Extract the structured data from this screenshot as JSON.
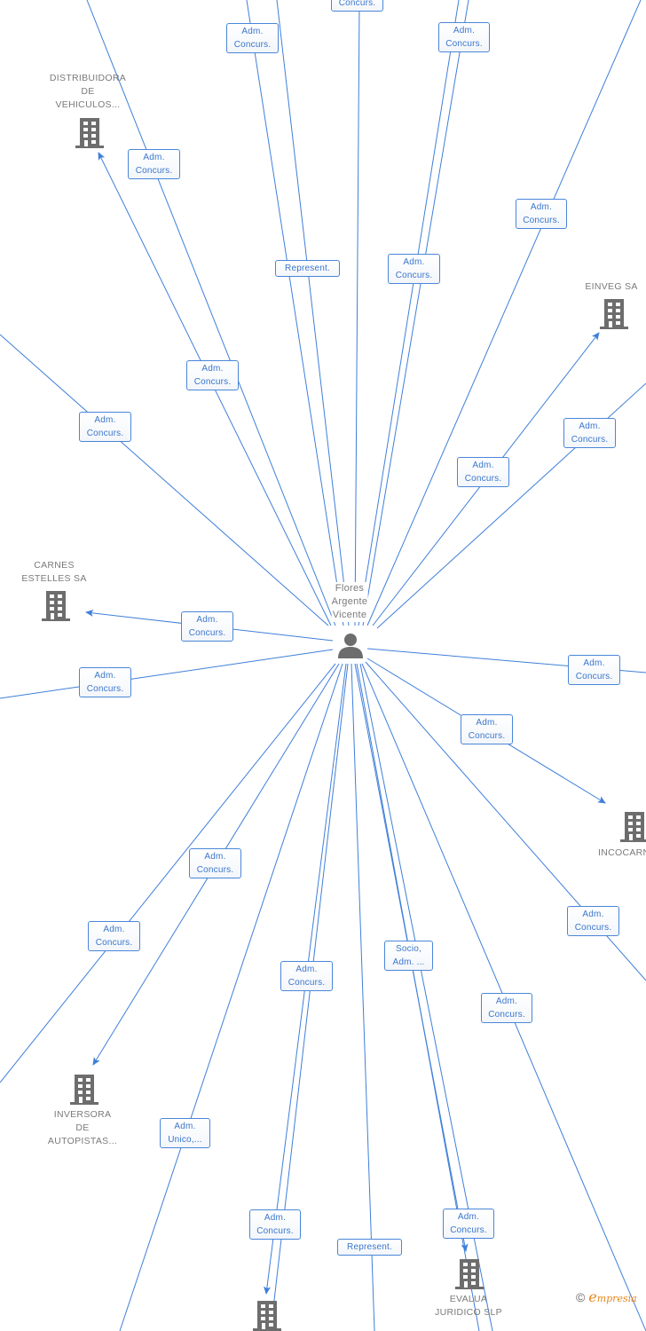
{
  "center": {
    "name_lines": [
      "Flores",
      "Argente",
      "Vicente"
    ],
    "icon": "person-icon"
  },
  "companies": [
    {
      "id": "distribuidora",
      "lines": [
        "DISTRIBUIDORA",
        "DE",
        "VEHICULOS..."
      ],
      "icon": "building-icon"
    },
    {
      "id": "einveg",
      "lines": [
        "EINVEG SA"
      ],
      "icon": "building-icon"
    },
    {
      "id": "carnes",
      "lines": [
        "CARNES",
        "ESTELLES SA"
      ],
      "icon": "building-icon"
    },
    {
      "id": "incocarn",
      "lines": [
        "INCOCARN"
      ],
      "icon": "building-icon"
    },
    {
      "id": "inversora",
      "lines": [
        "INVERSORA",
        "DE",
        "AUTOPISTAS..."
      ],
      "icon": "building-icon"
    },
    {
      "id": "evalua",
      "lines": [
        "EVALUA",
        "JURIDICO SLP"
      ],
      "icon": "building-icon"
    },
    {
      "id": "bottom-company",
      "lines": [],
      "icon": "building-icon"
    }
  ],
  "edge_labels": [
    {
      "lines": [
        "Concurs."
      ]
    },
    {
      "lines": [
        "Adm.",
        "Concurs."
      ]
    },
    {
      "lines": [
        "Adm.",
        "Concurs."
      ]
    },
    {
      "lines": [
        "Adm.",
        "Concurs."
      ]
    },
    {
      "lines": [
        "Adm.",
        "Concurs."
      ]
    },
    {
      "lines": [
        "Represent."
      ]
    },
    {
      "lines": [
        "Adm.",
        "Concurs."
      ]
    },
    {
      "lines": [
        "Adm.",
        "Concurs."
      ]
    },
    {
      "lines": [
        "Adm.",
        "Concurs."
      ]
    },
    {
      "lines": [
        "Adm.",
        "Concurs."
      ]
    },
    {
      "lines": [
        "Adm.",
        "Concurs."
      ]
    },
    {
      "lines": [
        "Adm.",
        "Concurs."
      ]
    },
    {
      "lines": [
        "Adm.",
        "Concurs."
      ]
    },
    {
      "lines": [
        "Adm.",
        "Concurs."
      ]
    },
    {
      "lines": [
        "Adm.",
        "Concurs."
      ]
    },
    {
      "lines": [
        "Adm.",
        "Concurs."
      ]
    },
    {
      "lines": [
        "Adm.",
        "Concurs."
      ]
    },
    {
      "lines": [
        "Adm.",
        "Concurs."
      ]
    },
    {
      "lines": [
        "Socio,",
        "Adm. ..."
      ]
    },
    {
      "lines": [
        "Adm.",
        "Concurs."
      ]
    },
    {
      "lines": [
        "Adm.",
        "Concurs."
      ]
    },
    {
      "lines": [
        "Adm.",
        "Unico,..."
      ]
    },
    {
      "lines": [
        "Adm.",
        "Concurs."
      ]
    },
    {
      "lines": [
        "Represent."
      ]
    },
    {
      "lines": [
        "Adm.",
        "Concurs."
      ]
    }
  ],
  "colors": {
    "edge": "#3f7fd9",
    "node": "#6d6d6d",
    "label_text": "#3a76cc",
    "brand": "#e8871e"
  },
  "footer": {
    "copyright": "©",
    "brand_initial": "e",
    "brand_rest": "mpresia"
  }
}
